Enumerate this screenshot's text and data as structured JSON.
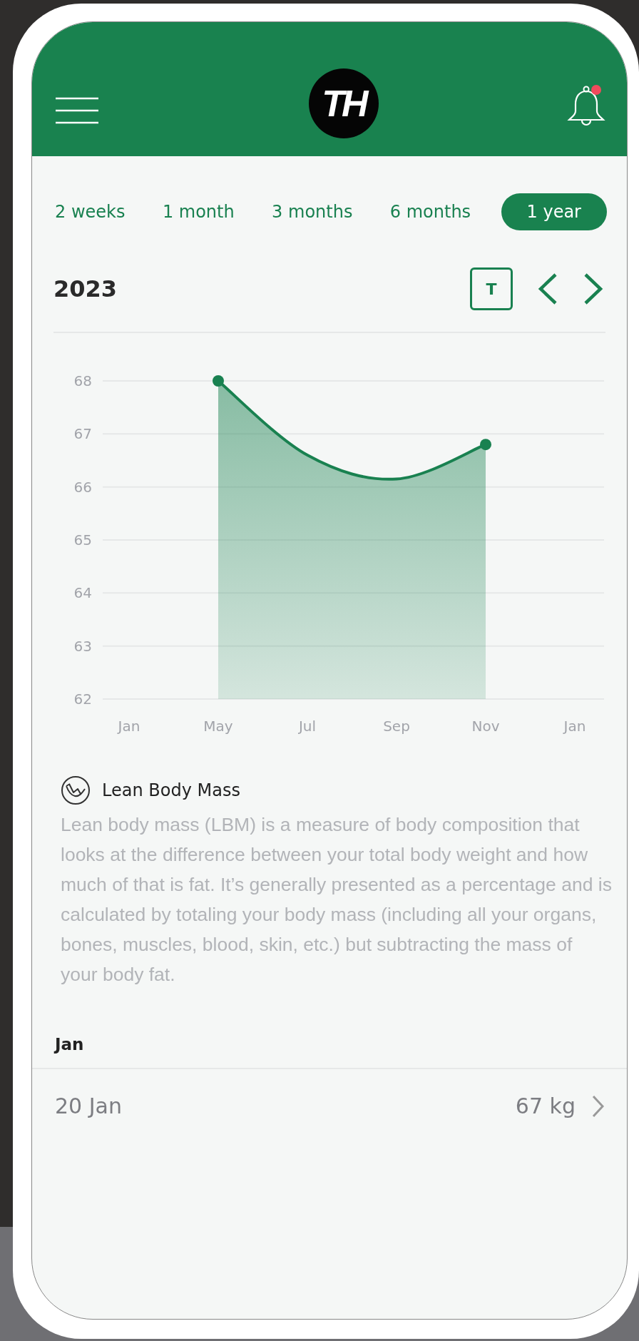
{
  "header": {
    "logo": "TH",
    "notification": true
  },
  "tabs": [
    {
      "label": "2 weeks",
      "selected": false
    },
    {
      "label": "1 month",
      "selected": false
    },
    {
      "label": "3 months",
      "selected": false
    },
    {
      "label": "6 months",
      "selected": false
    },
    {
      "label": "1 year",
      "selected": true
    }
  ],
  "period": {
    "title": "2023",
    "today_button": "T"
  },
  "chart_data": {
    "type": "area",
    "categories": [
      "Jan",
      "May",
      "Jul",
      "Sep",
      "Nov",
      "Jan"
    ],
    "series": [
      {
        "color": "#198150",
        "values": [
          null,
          68,
          66.6,
          66.15,
          66.8,
          null
        ]
      }
    ],
    "ylim": [
      62,
      68
    ],
    "grid": true,
    "yticks": [
      62,
      63,
      64,
      65,
      66,
      67,
      68
    ]
  },
  "info": {
    "title": "Lean Body Mass",
    "description": "Lean body mass (LBM) is a measure of body composition that looks at the difference between your total body weight and how much of that is fat. It’s generally presented as a percentage and is calculated by totaling your body mass (including all your organs, bones, muscles, blood, skin, etc.) but subtracting the mass of your body fat."
  },
  "month_group": {
    "title": "Jan",
    "entries": [
      {
        "date": "20 Jan",
        "value": "67 kg"
      }
    ]
  }
}
